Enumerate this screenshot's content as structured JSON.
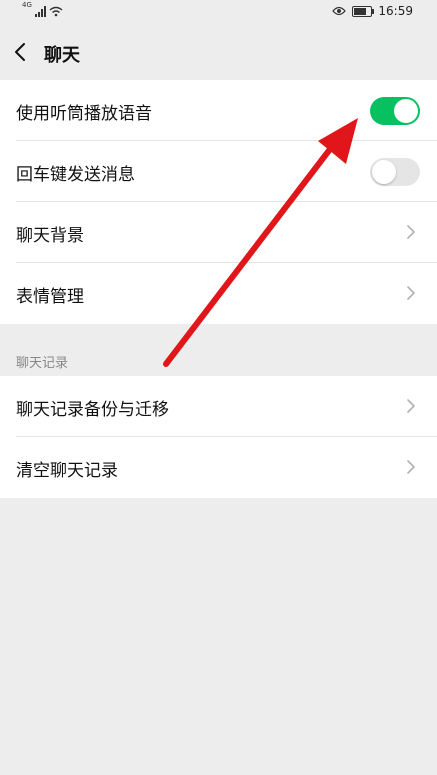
{
  "status_bar": {
    "network_label": "4G",
    "time": "16:59"
  },
  "nav": {
    "title": "聊天"
  },
  "settings": {
    "items": [
      {
        "label": "使用听筒播放语音",
        "control": "toggle",
        "on": true
      },
      {
        "label": "回车键发送消息",
        "control": "toggle",
        "on": false
      },
      {
        "label": "聊天背景",
        "control": "chevron"
      },
      {
        "label": "表情管理",
        "control": "chevron"
      }
    ]
  },
  "chat_history": {
    "header": "聊天记录",
    "items": [
      {
        "label": "聊天记录备份与迁移",
        "control": "chevron"
      },
      {
        "label": "清空聊天记录",
        "control": "chevron"
      }
    ]
  },
  "colors": {
    "accent_green": "#07c160",
    "background": "#ededed",
    "annotation_arrow": "#e0161b"
  }
}
